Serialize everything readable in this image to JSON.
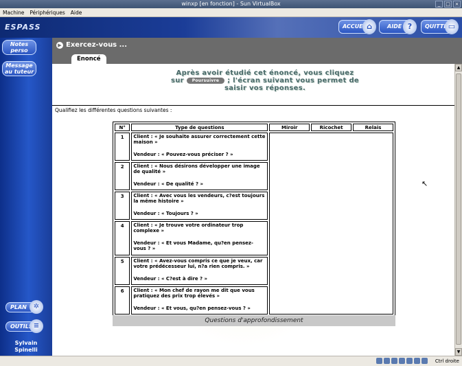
{
  "window": {
    "title": "winxp [en fonction] - Sun VirtualBox",
    "min": "_",
    "max": "□",
    "close": "×"
  },
  "menu": [
    "Machine",
    "Périphériques",
    "Aide"
  ],
  "header": {
    "logo": "ESPASS",
    "buttons": {
      "accueil": "ACCUEIL",
      "aide": "AIDE",
      "quitter": "QUITTER"
    }
  },
  "sidebar": {
    "notes": [
      "Notes",
      "perso"
    ],
    "message": [
      "Message",
      "au tuteur"
    ],
    "plan": "PLAN",
    "outils": "OUTILS",
    "author": [
      "Sylvain",
      "Spinelli"
    ]
  },
  "main": {
    "title": "Exercez-vous ...",
    "tab": "Enoncé",
    "instructions": {
      "line1": "Après avoir étudié cet énoncé, vous cliquez",
      "sur": "sur",
      "button": "Poursuivre",
      "line2_rest": "; l'écran suivant vous permet de",
      "line3": "saisir vos réponses."
    },
    "question": "Qualifiez les différentes questions suivantes :",
    "table": {
      "headers": [
        "N°",
        "Type de questions",
        "Miroir",
        "Ricochet",
        "Relais"
      ],
      "rows": [
        {
          "n": "1",
          "client": "Client : « Je souhaite assurer correctement cette maison »",
          "vendeur": "Vendeur : « Pouvez-vous préciser ? »"
        },
        {
          "n": "2",
          "client": "Client : « Nous désirons développer une image de qualité »",
          "vendeur": "Vendeur : « De qualité ? »"
        },
        {
          "n": "3",
          "client": "Client : « Avec vous les vendeurs, c?est toujours la même histoire »",
          "vendeur": "Vendeur : « Toujours ? »"
        },
        {
          "n": "4",
          "client": "Client : « Je trouve votre ordinateur trop complexe »",
          "vendeur": "Vendeur : « Et vous Madame, qu?en pensez-vous ? »"
        },
        {
          "n": "5",
          "client": "Client : « Avez-vous compris ce que je veux, car votre prédécesseur lui, n?a rien compris. »",
          "vendeur": "Vendeur : « C?est à dire ? »"
        },
        {
          "n": "6",
          "client": "Client : « Mon chef de rayon me dit que vous pratiquez des prix trop élevés »",
          "vendeur": "Vendeur : « Et vous, qu?en pensez-vous ? »"
        }
      ],
      "footer": "Questions d'approfondissement"
    }
  },
  "status": {
    "host_key": "Ctrl droite"
  }
}
